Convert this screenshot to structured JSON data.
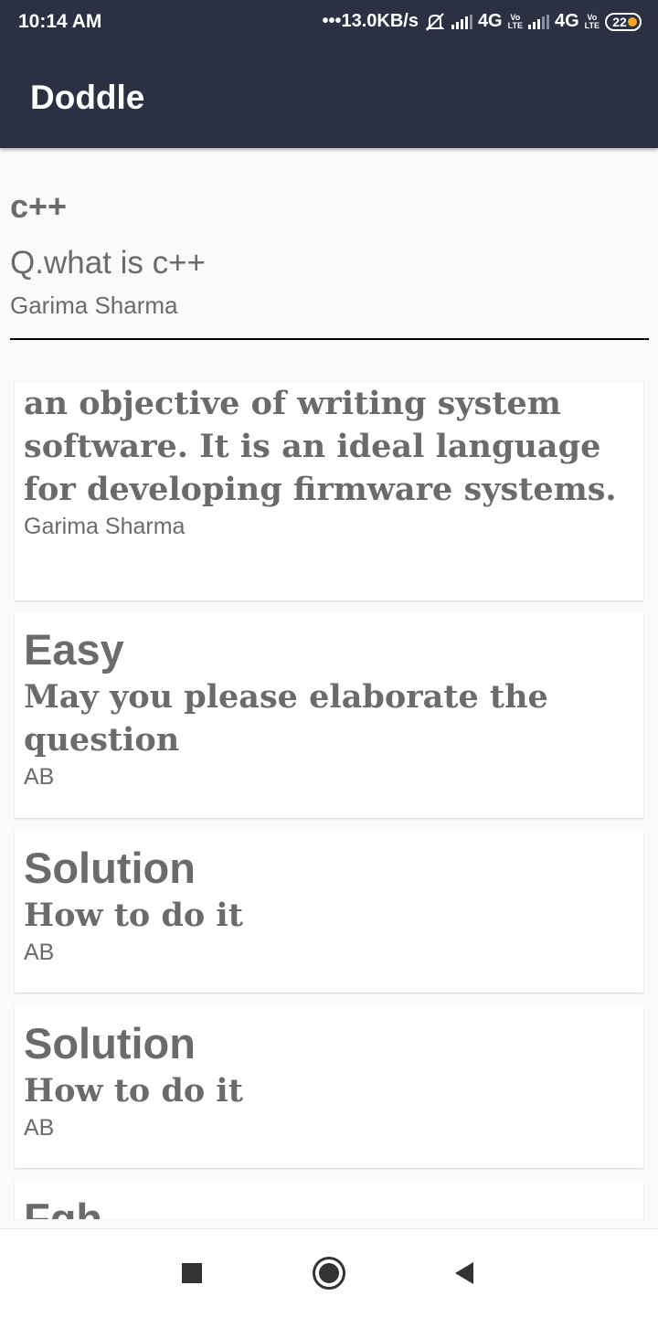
{
  "status_bar": {
    "time": "10:14 AM",
    "network_speed": "•••13.0KB/s",
    "network1": "4G",
    "network2": "4G",
    "volte1_top": "Vo",
    "volte1_bottom": "LTE",
    "volte2_top": "Vo",
    "volte2_bottom": "LTE",
    "battery": "22"
  },
  "app_bar": {
    "title": "Doddle"
  },
  "question": {
    "topic": "c++",
    "text": "Q.what is c++",
    "author": "Garima Sharma"
  },
  "answers": [
    {
      "title": "",
      "body": "an objective of writing system software. It is an ideal language for developing firmware systems.",
      "author": "Garima Sharma"
    },
    {
      "title": "Easy",
      "body": "May you please elaborate the question",
      "author": "AB"
    },
    {
      "title": "Solution",
      "body": "How to do it",
      "author": "AB"
    },
    {
      "title": "Solution",
      "body": "How to do it",
      "author": "AB"
    },
    {
      "title": "Fgh",
      "body": "",
      "author": ""
    }
  ],
  "nav_bar": {
    "icons": [
      "recents-icon",
      "home-icon",
      "back-icon"
    ]
  },
  "colors": {
    "app_bar": "#2b3042",
    "text": "#6b6b6b",
    "battery_accent": "#f5a623"
  }
}
